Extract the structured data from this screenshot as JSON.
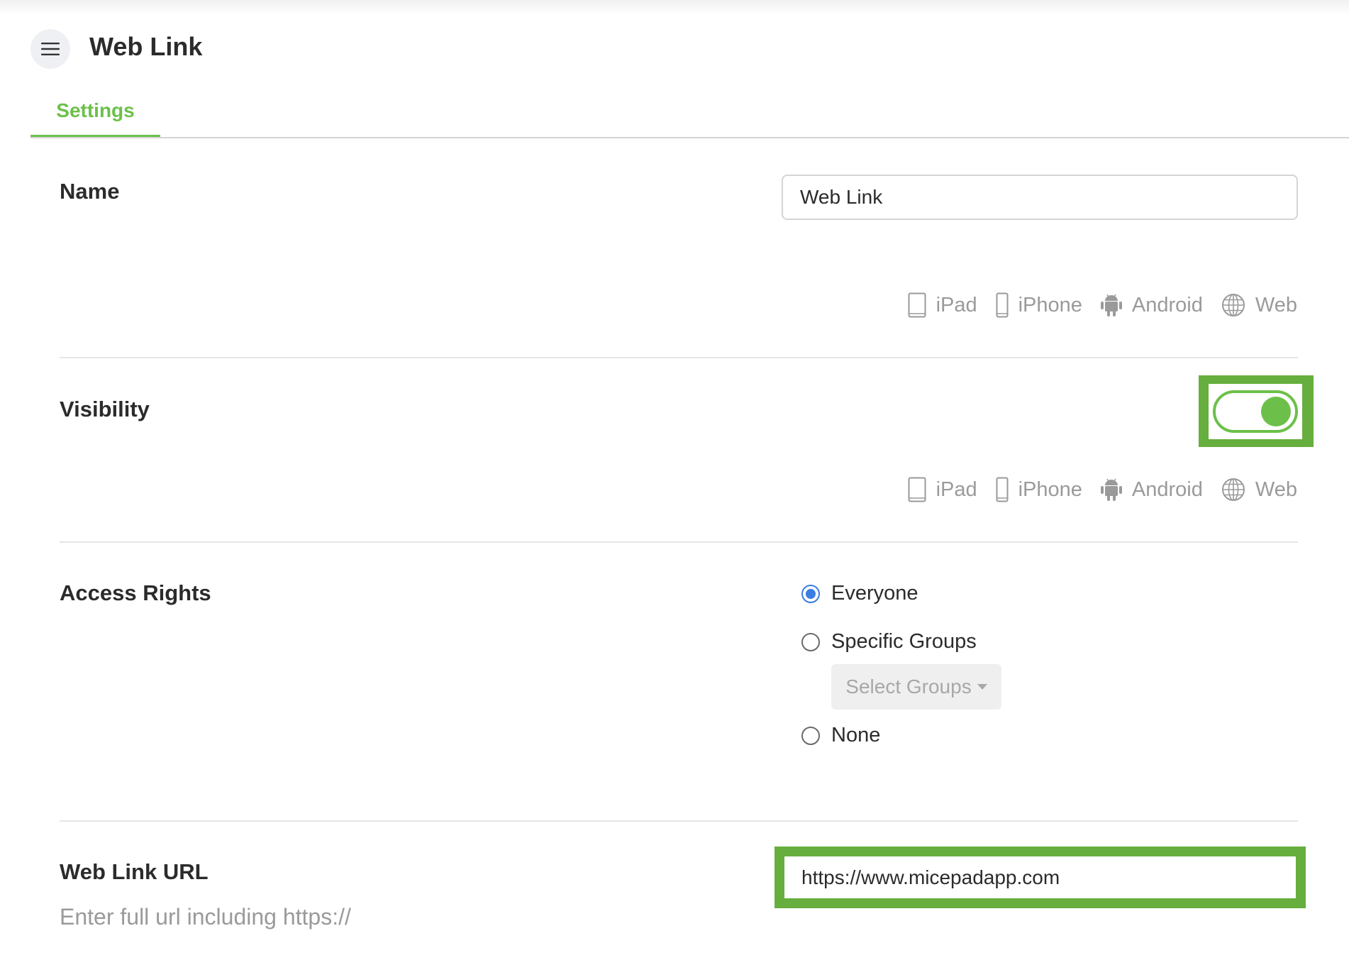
{
  "header": {
    "title": "Web Link",
    "menu_icon": "hamburger-menu-icon"
  },
  "tabs": [
    {
      "label": "Settings",
      "active": true
    }
  ],
  "accent_color": "#6cc04a",
  "highlight_color": "#66ae3d",
  "radio_color": "#3b7de0",
  "name_section": {
    "label": "Name",
    "value": "Web Link",
    "platforms": [
      "iPad",
      "iPhone",
      "Android",
      "Web"
    ]
  },
  "visibility_section": {
    "label": "Visibility",
    "enabled": true,
    "platforms": [
      "iPad",
      "iPhone",
      "Android",
      "Web"
    ]
  },
  "access_section": {
    "label": "Access Rights",
    "options": [
      {
        "label": "Everyone",
        "checked": true
      },
      {
        "label": "Specific Groups",
        "checked": false
      },
      {
        "label": "None",
        "checked": false
      }
    ],
    "select_groups_label": "Select Groups"
  },
  "url_section": {
    "label": "Web Link URL",
    "hint": "Enter full url including https://",
    "value": "https://www.micepadapp.com"
  }
}
